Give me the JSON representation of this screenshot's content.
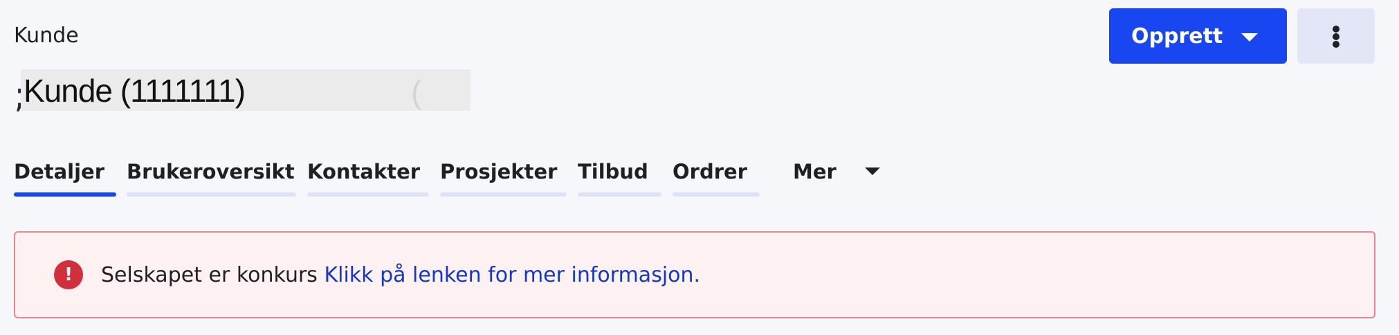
{
  "breadcrumb": {
    "label": "Kunde"
  },
  "page_title": {
    "text": "Kunde (1111111)",
    "ghost_prefix": ";",
    "ghost_paren": "("
  },
  "header_actions": {
    "create_label": "Opprett",
    "more_options_icon": "vertical-ellipsis-icon"
  },
  "tabs": [
    {
      "label": "Detaljer",
      "active": true
    },
    {
      "label": "Brukeroversikt",
      "active": false
    },
    {
      "label": "Kontakter",
      "active": false
    },
    {
      "label": "Prosjekter",
      "active": false
    },
    {
      "label": "Tilbud",
      "active": false
    },
    {
      "label": "Ordrer",
      "active": false
    },
    {
      "label": "Mer",
      "active": false
    }
  ],
  "alert": {
    "icon": "exclamation-icon",
    "icon_glyph": "!",
    "message": "Selskapet er konkurs",
    "link_text": "Klikk på lenken for mer informasjon."
  },
  "colors": {
    "accent": "#1846f0",
    "danger": "#d22f3c",
    "link": "#1338c9",
    "background": "#f6f7fb"
  }
}
